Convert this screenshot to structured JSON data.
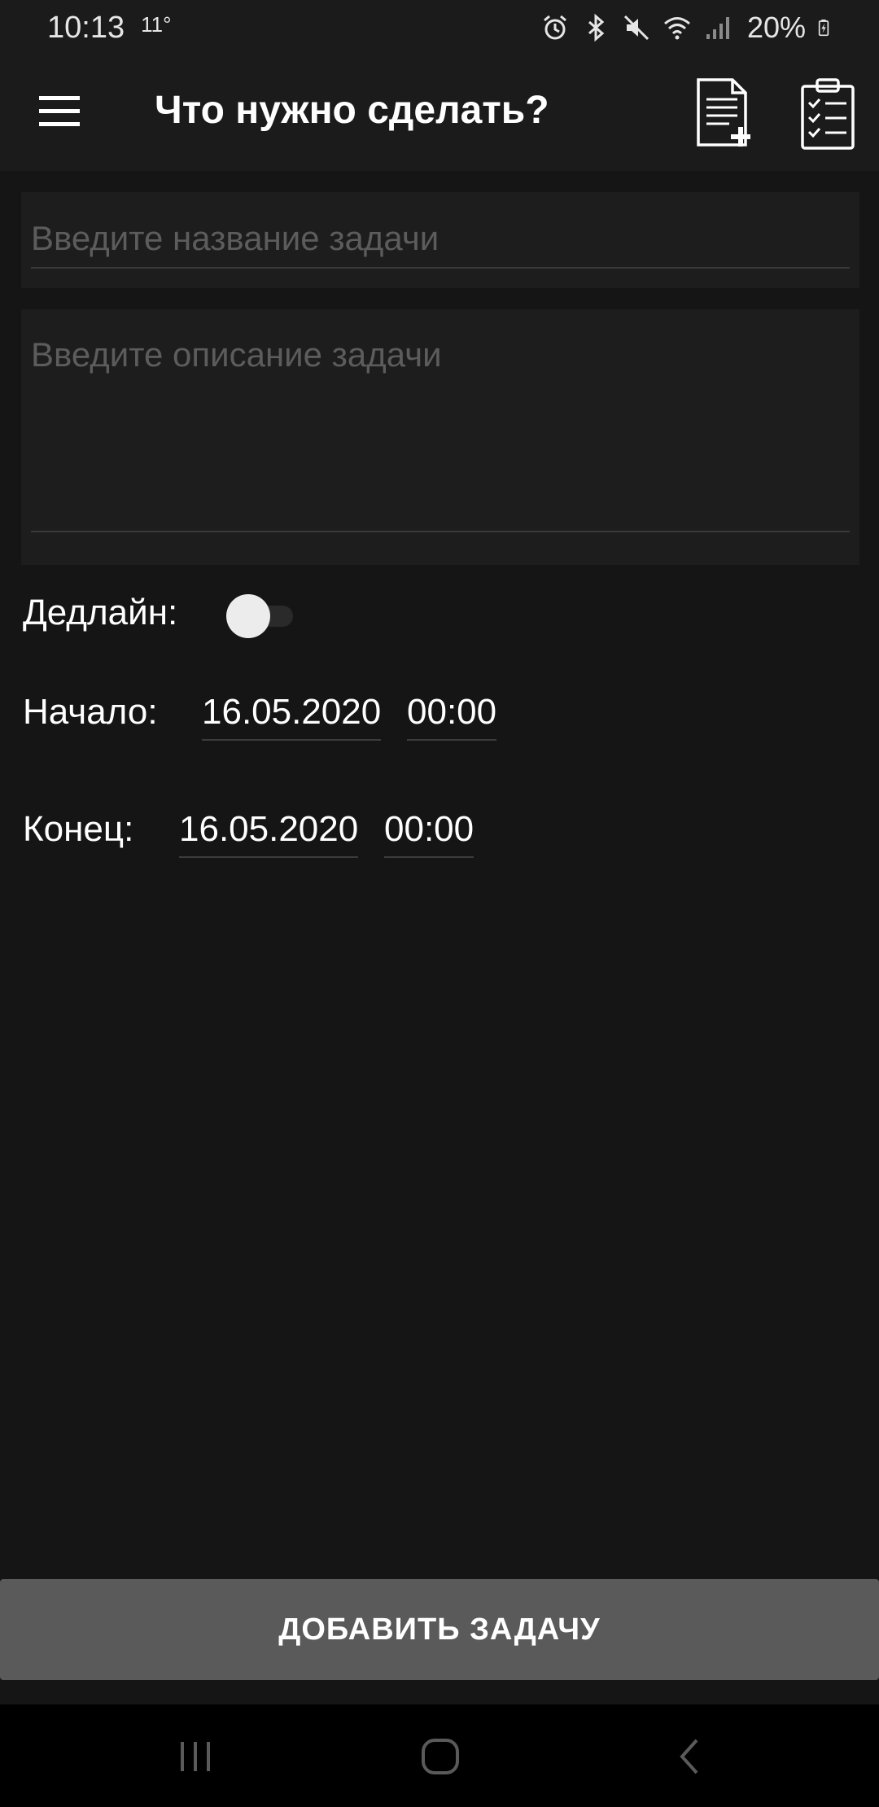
{
  "status_bar": {
    "time": "10:13",
    "temperature": "11°",
    "battery": "20%",
    "icons": [
      "alarm-icon",
      "bluetooth-icon",
      "mute-icon",
      "wifi-icon",
      "signal-icon",
      "battery-charging-icon"
    ]
  },
  "app_bar": {
    "title": "Что нужно сделать?",
    "menu_icon": "hamburger-menu-icon",
    "actions": [
      "new-document-icon",
      "checklist-icon"
    ]
  },
  "form": {
    "title_placeholder": "Введите название задачи",
    "title_value": "",
    "description_placeholder": "Введите описание задачи",
    "description_value": "",
    "deadline_label": "Дедлайн:",
    "deadline_enabled": false,
    "start_label": "Начало:",
    "start_date": "16.05.2020",
    "start_time": "00:00",
    "end_label": "Конец:",
    "end_date": "16.05.2020",
    "end_time": "00:00"
  },
  "add_button_label": "ДОБАВИТЬ ЗАДАЧУ",
  "nav_bar": {
    "icons": [
      "recent-apps-icon",
      "home-icon",
      "back-icon"
    ]
  },
  "colors": {
    "background": "#151515",
    "app_bar": "#1b1b1b",
    "field_background": "#1d1d1d",
    "button_background": "#5a5a5a",
    "placeholder": "#5c5c5c"
  }
}
